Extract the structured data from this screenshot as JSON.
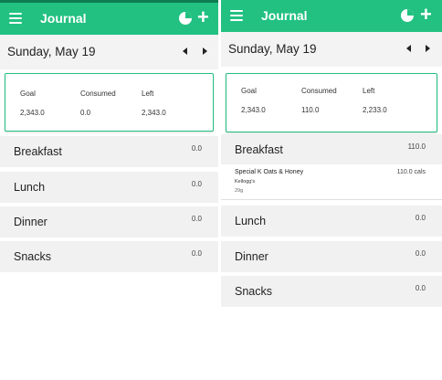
{
  "colors": {
    "accent": "#22c181",
    "accent_dark": "#0d7d52",
    "section_bg": "#f1f1f1"
  },
  "app": {
    "title": "Journal",
    "menu_icon": "hamburger-icon",
    "report_icon": "pie-chart-icon",
    "add_label": "+"
  },
  "left": {
    "date": "Sunday, May 19",
    "summary": {
      "goal_label": "Goal",
      "goal": "2,343.0",
      "consumed_label": "Consumed",
      "consumed": "0.0",
      "left_label": "Left",
      "left": "2,343.0"
    },
    "meals": [
      {
        "name": "Breakfast",
        "calories": "0.0"
      },
      {
        "name": "Lunch",
        "calories": "0.0"
      },
      {
        "name": "Dinner",
        "calories": "0.0"
      },
      {
        "name": "Snacks",
        "calories": "0.0"
      }
    ]
  },
  "right": {
    "date": "Sunday, May 19",
    "summary": {
      "goal_label": "Goal",
      "goal": "2,343.0",
      "consumed_label": "Consumed",
      "consumed": "110.0",
      "left_label": "Left",
      "left": "2,233.0"
    },
    "meals": [
      {
        "name": "Breakfast",
        "calories": "110.0"
      },
      {
        "name": "Lunch",
        "calories": "0.0"
      },
      {
        "name": "Dinner",
        "calories": "0.0"
      },
      {
        "name": "Snacks",
        "calories": "0.0"
      }
    ],
    "food": {
      "name": "Special K Oats & Honey",
      "brand": "Kellogg's",
      "portion": "29g",
      "calories": "110.0 cals"
    }
  }
}
